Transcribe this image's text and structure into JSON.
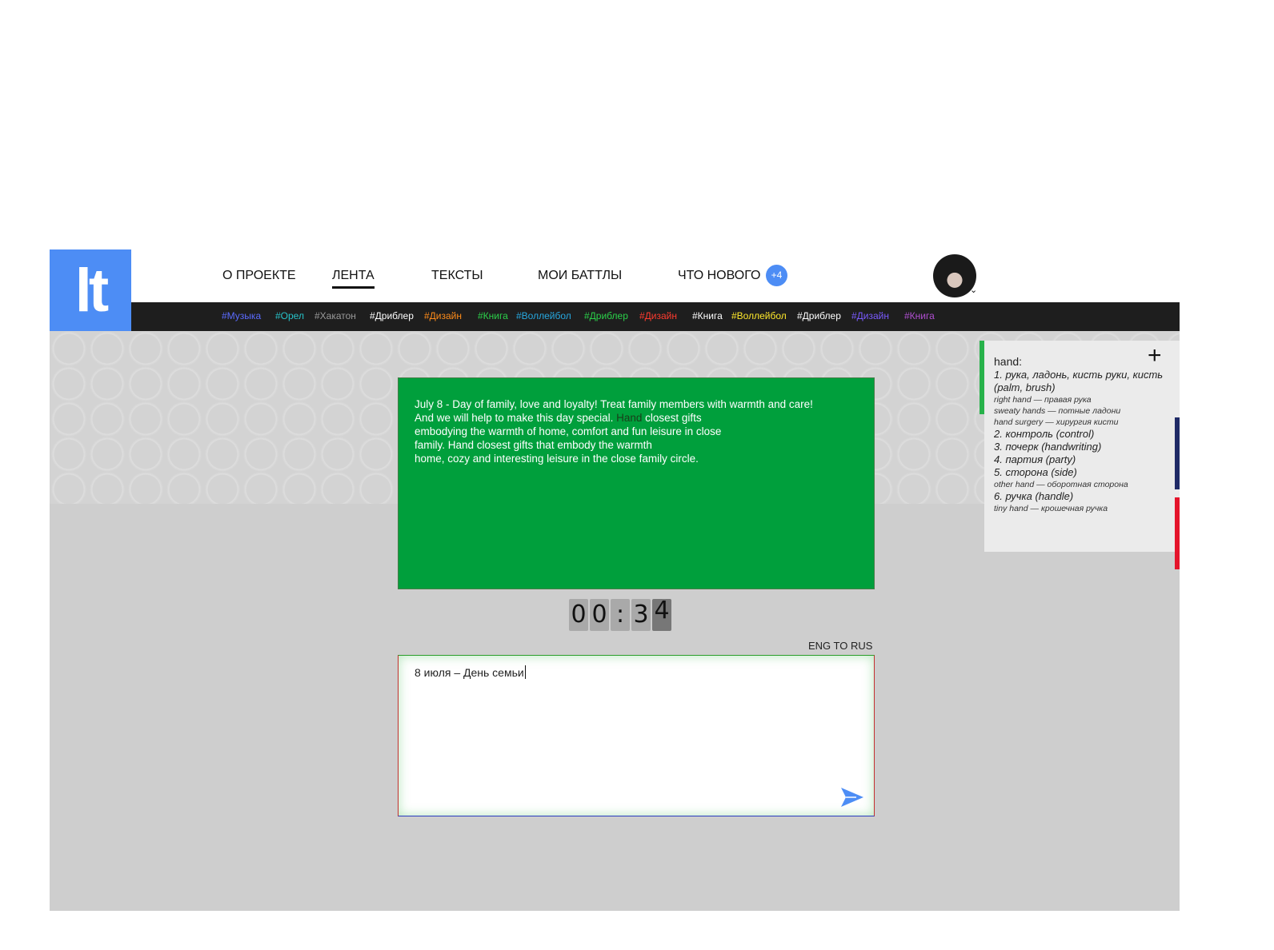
{
  "logo": {
    "text": "lt"
  },
  "nav": {
    "items": [
      {
        "label": "О ПРОЕКТЕ"
      },
      {
        "label": "ЛЕНТА"
      },
      {
        "label": "ТЕКСТЫ"
      },
      {
        "label": "МОИ БАТТЛЫ"
      },
      {
        "label": "ЧТО НОВОГО"
      }
    ],
    "active_index": 1,
    "news_badge": "+4"
  },
  "tags": [
    {
      "label": "#Музыка",
      "color": "#5b6bff"
    },
    {
      "label": "#Орел",
      "color": "#27c2c8"
    },
    {
      "label": "#Хакатон",
      "color": "#9a9a9a"
    },
    {
      "label": "#Дриблер",
      "color": "#ffffff"
    },
    {
      "label": "#Дизайн",
      "color": "#ff8c1a"
    },
    {
      "label": "#Книга",
      "color": "#2bd14a"
    },
    {
      "label": "#Воллейбол",
      "color": "#27a8e0"
    },
    {
      "label": "#Дриблер",
      "color": "#2bd14a"
    },
    {
      "label": "#Дизайн",
      "color": "#ff3b2f"
    },
    {
      "label": "#Книга",
      "color": "#ffffff"
    },
    {
      "label": "#Воллейбол",
      "color": "#ffe92b"
    },
    {
      "label": "#Дриблер",
      "color": "#ffffff"
    },
    {
      "label": "#Дизайн",
      "color": "#7a5bff"
    },
    {
      "label": "#Книга",
      "color": "#b04fd1"
    }
  ],
  "card": {
    "text_before": "July 8 - Day of family, love and loyalty! Treat family members with warmth and care!\nAnd we will help to make this day special. ",
    "highlight": "Hand",
    "text_after": " closest gifts\nembodying the warmth of home, comfort and fun leisure in close\nfamily. Hand closest gifts that embody the warmth\nhome, cozy and interesting leisure in the close family circle.",
    "background": "#009f3c"
  },
  "timer": {
    "digits": [
      "0",
      "0",
      ":",
      "3",
      "4"
    ]
  },
  "translation": {
    "direction_label": "ENG TO RUS",
    "input_value": "8 июля – День семьи"
  },
  "dictionary": {
    "word": "hand:",
    "entries": [
      {
        "def": "1. рука, ладонь, кисть руки, кисть (palm, brush)",
        "examples": [
          "right hand — правая рука",
          "sweaty hands — потные ладони",
          "hand surgery — хирургия кисти"
        ]
      },
      {
        "def": "2. контроль (control)",
        "examples": []
      },
      {
        "def": "3. почерк (handwriting)",
        "examples": []
      },
      {
        "def": "4. партия (party)",
        "examples": []
      },
      {
        "def": "5. сторона (side)",
        "examples": [
          "other hand — оборотная сторона"
        ]
      },
      {
        "def": "6. ручка (handle)",
        "examples": [
          "tiny hand — крошечная ручка"
        ]
      }
    ],
    "accent": "#27b24a",
    "side_strips": [
      "#1f2a66",
      "#e4142b"
    ]
  }
}
